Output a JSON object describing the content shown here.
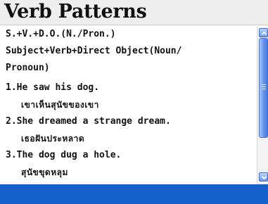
{
  "header": {
    "title": "Verb Patterns"
  },
  "content": {
    "lines": [
      {
        "text": "S.+V.+D.O.(N./Pron.)",
        "lang": "en"
      },
      {
        "text": "Subject+Verb+Direct Object(Noun/",
        "lang": "en"
      },
      {
        "text": "Pronoun)",
        "lang": "en"
      },
      {
        "text": "1.He saw his dog.",
        "lang": "en"
      },
      {
        "text": "เขาเห็นสุนัขของเขา",
        "lang": "th"
      },
      {
        "text": "2.She dreamed a strange dream.",
        "lang": "en"
      },
      {
        "text": "เธอฝันประหลาด",
        "lang": "th"
      },
      {
        "text": "3.The dog dug a hole.",
        "lang": "en"
      },
      {
        "text": "สุนัขขุดหลุม",
        "lang": "th"
      }
    ]
  },
  "scrollbar": {
    "up_icon": "arrow-up-icon",
    "down_icon": "arrow-down-icon",
    "visible_fraction": 0.68
  },
  "colors": {
    "accent": "#1560c9",
    "scroll_thumb": "#5d8ee8"
  }
}
